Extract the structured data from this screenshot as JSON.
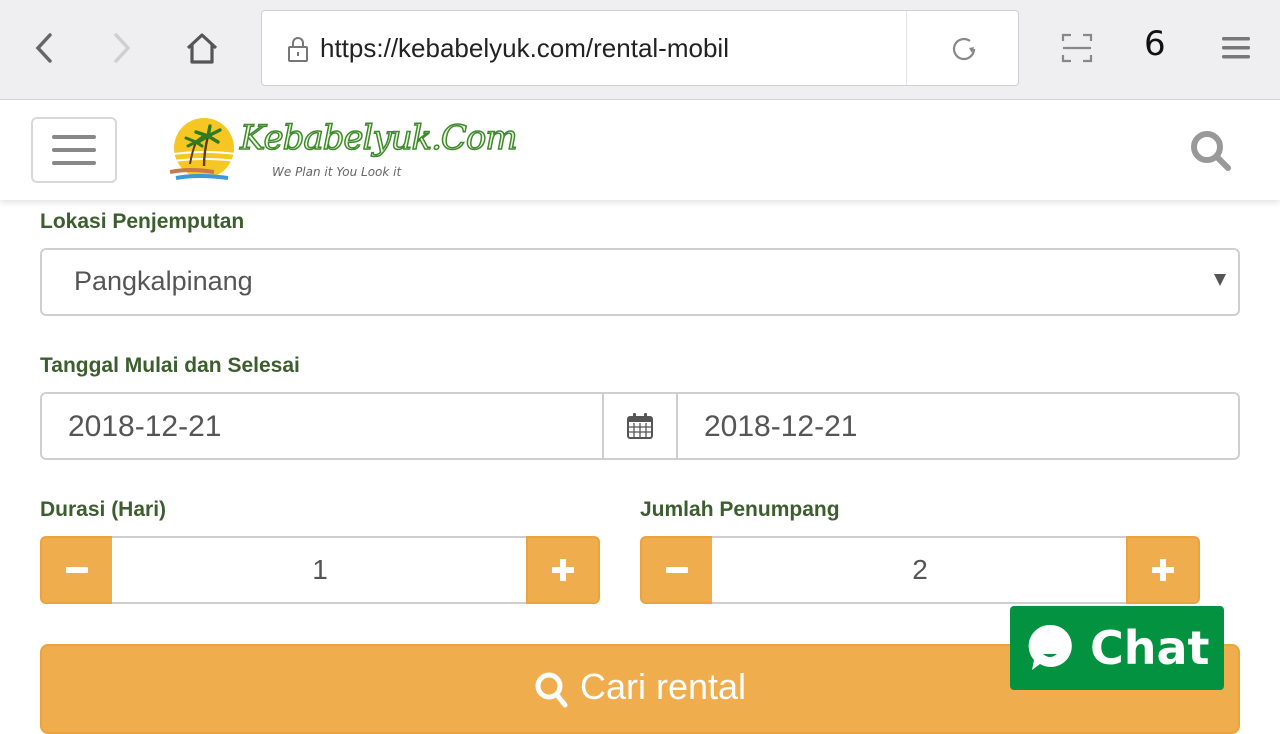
{
  "browser": {
    "url": "https://kebabelyuk.com/rental-mobil",
    "tab_count": "6",
    "icons": {
      "back": "chevron-left-icon",
      "forward": "chevron-right-icon",
      "home": "home-icon",
      "lock": "lock-icon",
      "reload": "reload-icon",
      "scan": "scan-icon",
      "menu": "menu-icon"
    }
  },
  "header": {
    "logo_text": "Kebabelyuk.Com",
    "logo_tagline": "We Plan it You Look it",
    "icons": {
      "menu": "hamburger-icon",
      "search": "search-icon"
    }
  },
  "form": {
    "pickup": {
      "label": "Lokasi Penjemputan",
      "selected": "Pangkalpinang"
    },
    "dates": {
      "label": "Tanggal Mulai dan Selesai",
      "start": "2018-12-21",
      "end": "2018-12-21"
    },
    "duration": {
      "label": "Durasi (Hari)",
      "value": "1"
    },
    "passengers": {
      "label": "Jumlah Penumpang",
      "value": "2"
    },
    "submit_label": "Cari rental"
  },
  "chat": {
    "label": "Chat"
  },
  "colors": {
    "accent": "#efad4e",
    "label_green": "#3b5e2d",
    "chat_green": "#03923f"
  }
}
